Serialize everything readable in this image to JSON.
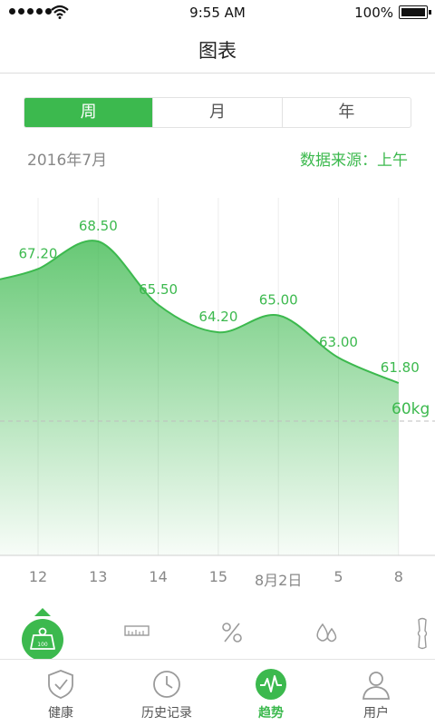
{
  "status_bar": {
    "time": "9:55 AM",
    "battery": "100%"
  },
  "nav": {
    "title": "图表"
  },
  "tabs_period": [
    {
      "label": "周",
      "active": true
    },
    {
      "label": "月",
      "active": false
    },
    {
      "label": "年",
      "active": false
    }
  ],
  "period": {
    "date": "2016年7月",
    "source": "数据来源：上午"
  },
  "chart_data": {
    "type": "area",
    "x": [
      "12",
      "13",
      "14",
      "15",
      "8月2日",
      "5",
      "8"
    ],
    "values": [
      67.2,
      68.5,
      65.5,
      64.2,
      65.0,
      63.0,
      61.8
    ],
    "data_labels": [
      "67.20",
      "68.50",
      "65.50",
      "64.20",
      "65.00",
      "63.00",
      "61.80"
    ],
    "reference_line": {
      "value": 60,
      "label": "60kg"
    },
    "color": "#3cb94e"
  },
  "metrics": [
    {
      "name": "weight-icon",
      "value_text": "100",
      "active": true
    },
    {
      "name": "ruler-icon",
      "active": false
    },
    {
      "name": "percent-icon",
      "active": false
    },
    {
      "name": "water-drops-icon",
      "active": false
    },
    {
      "name": "bone-icon",
      "active": false
    }
  ],
  "tab_bar": [
    {
      "label": "健康",
      "icon": "shield-check-icon",
      "active": false
    },
    {
      "label": "历史记录",
      "icon": "clock-icon",
      "active": false
    },
    {
      "label": "趋势",
      "icon": "pulse-icon",
      "active": true
    },
    {
      "label": "用户",
      "icon": "user-icon",
      "active": false
    }
  ],
  "colors": {
    "accent": "#3cb94e",
    "text_muted": "#888888"
  }
}
